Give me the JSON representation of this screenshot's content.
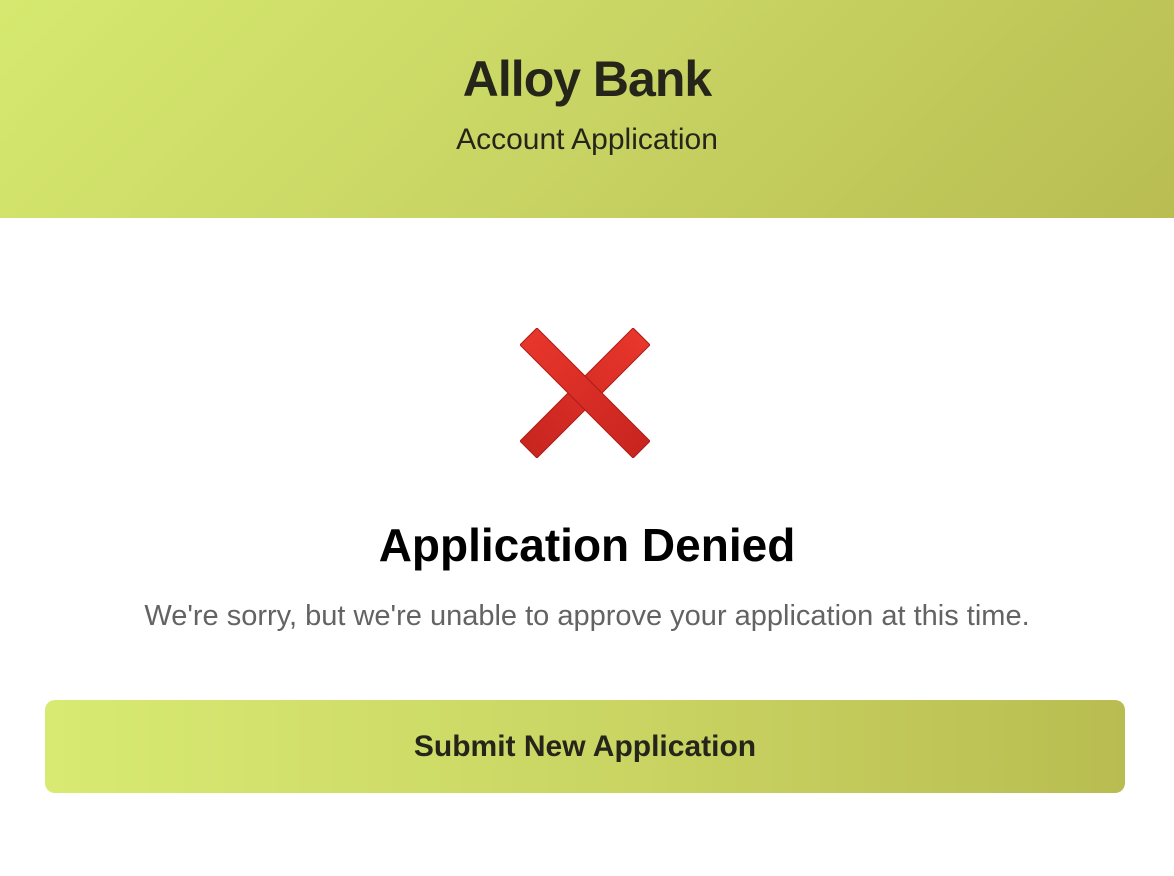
{
  "header": {
    "brand": "Alloy Bank",
    "subtitle": "Account Application"
  },
  "result": {
    "icon": "cross-mark-icon",
    "title": "Application Denied",
    "message": "We're sorry, but we're unable to approve your application at this time."
  },
  "actions": {
    "submit_new_label": "Submit New Application"
  },
  "colors": {
    "header_gradient_start": "#d6e96f",
    "header_gradient_end": "#b9bd52",
    "icon_red": "#d82e26",
    "text_dark": "#25251a",
    "message_gray": "#636363"
  }
}
